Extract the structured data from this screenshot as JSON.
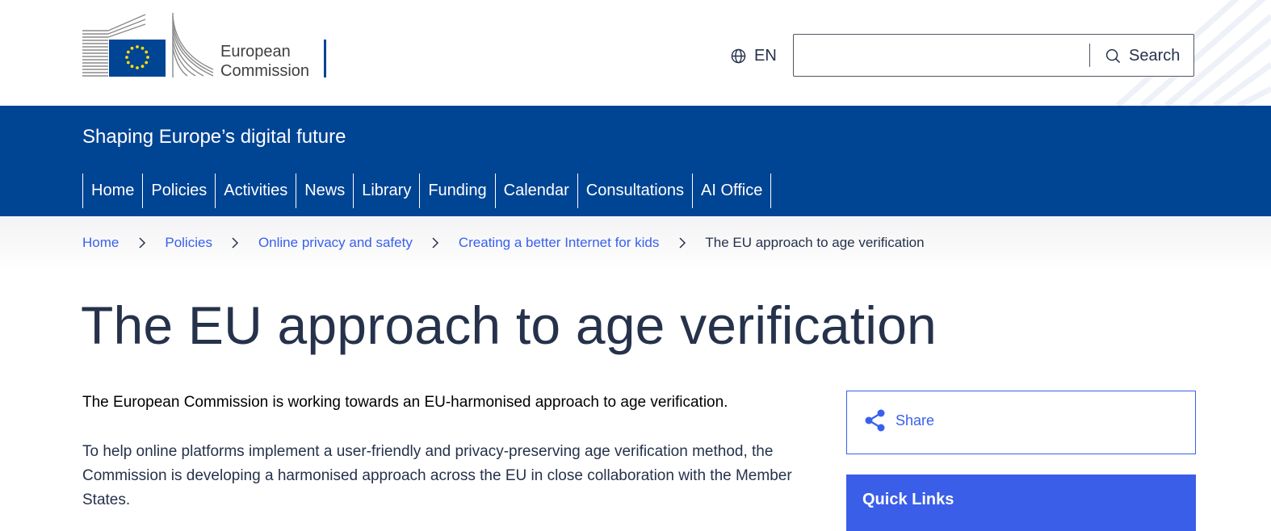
{
  "header": {
    "logo_line1": "European",
    "logo_line2": "Commission",
    "language": "EN",
    "search": {
      "placeholder": "",
      "button_label": "Search"
    }
  },
  "site": {
    "name": "Shaping Europe’s digital future"
  },
  "nav": {
    "items": [
      {
        "label": "Home"
      },
      {
        "label": "Policies"
      },
      {
        "label": "Activities"
      },
      {
        "label": "News"
      },
      {
        "label": "Library"
      },
      {
        "label": "Funding"
      },
      {
        "label": "Calendar"
      },
      {
        "label": "Consultations"
      },
      {
        "label": "AI Office"
      }
    ]
  },
  "breadcrumb": {
    "items": [
      {
        "label": "Home"
      },
      {
        "label": "Policies"
      },
      {
        "label": "Online privacy and safety"
      },
      {
        "label": "Creating a better Internet for kids"
      }
    ],
    "current": "The EU approach to age verification"
  },
  "page": {
    "title": "The EU approach to age verification",
    "intro": "The European Commission is working towards an EU-harmonised approach to age verification.",
    "paragraph": "To help online platforms implement a user-friendly and privacy-preserving age verification method, the Commission is developing a harmonised approach across the EU in close collaboration with the Member States."
  },
  "sidebar": {
    "share_label": "Share",
    "quick_links_title": "Quick Links"
  },
  "colors": {
    "ec_blue": "#004494",
    "link_blue": "#3860ed",
    "text_dark": "#26324b",
    "eu_yellow": "#ffdd00"
  },
  "icons": [
    "globe-icon",
    "search-icon",
    "share-icon",
    "chevron-right-icon"
  ]
}
